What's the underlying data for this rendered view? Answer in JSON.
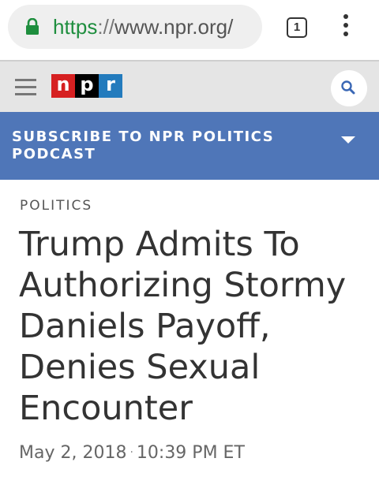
{
  "browser": {
    "url_scheme": "https",
    "url_separator": "://",
    "url_host": "www.npr.org/",
    "tab_count": "1",
    "lock_icon": "lock-icon",
    "menu_icon": "more-vert-icon",
    "secure_color": "#1e8e3e"
  },
  "header": {
    "menu_icon": "hamburger-icon",
    "logo_letters": [
      "n",
      "p",
      "r"
    ],
    "logo_colors": [
      "#d62021",
      "#000000",
      "#237bbd"
    ],
    "search_icon": "search-icon"
  },
  "banner": {
    "text": "SUBSCRIBE TO NPR POLITICS PODCAST",
    "icon": "chevron-down-icon",
    "background": "#4f76b8"
  },
  "article": {
    "section": "POLITICS",
    "headline": "Trump Admits To Authorizing Stormy Daniels Payoff, Denies Sexual Encounter",
    "date": "May 2, 2018",
    "separator": "·",
    "time": "10:39 PM ET"
  }
}
